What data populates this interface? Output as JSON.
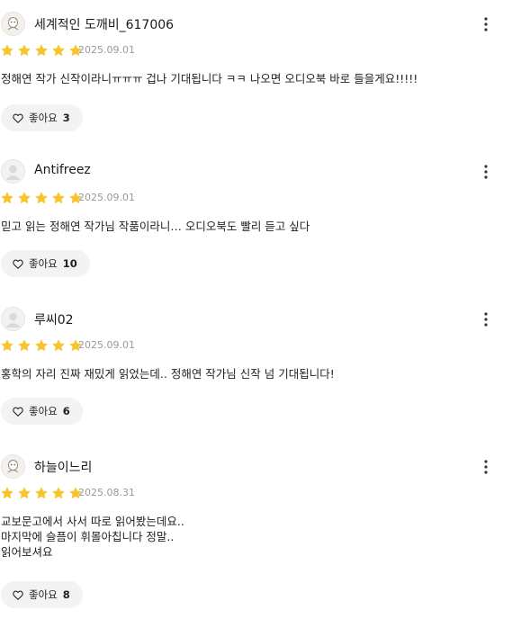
{
  "reviews": [
    {
      "username": "세계적인 도깨비_617006",
      "avatar": "doodle-avatar",
      "rating": 5,
      "date": "2025.09.01",
      "lines": [
        "정해연 작가 신작이라니ㅠㅠㅠ 겁나 기대됩니다 ㅋㅋ 나오면 오디오북 바로 들을게요!!!!!"
      ],
      "like_label": "좋아요",
      "like_count": "3"
    },
    {
      "username": "Antifreez",
      "avatar": "default-avatar",
      "rating": 5,
      "date": "2025.09.01",
      "lines": [
        "믿고 읽는 정해연 작가님 작품이라니… 오디오북도 빨리 듣고 싶다"
      ],
      "like_label": "좋아요",
      "like_count": "10"
    },
    {
      "username": "루씨02",
      "avatar": "default-avatar",
      "rating": 5,
      "date": "2025.09.01",
      "lines": [
        "홍학의 자리 진짜 재밌게 읽었는데.. 정해연 작가님 신작 넘 기대됩니다!"
      ],
      "like_label": "좋아요",
      "like_count": "6"
    },
    {
      "username": "하늘이느리",
      "avatar": "doodle-avatar",
      "rating": 5,
      "date": "2025.08.31",
      "lines": [
        "교보문고에서 사서 따로 읽어봤는데요..",
        "마지막에 슬픔이 휘몰아칩니다 정말..",
        "읽어보셔요"
      ],
      "like_label": "좋아요",
      "like_count": "8"
    }
  ],
  "colors": {
    "star": "#f7c42c",
    "date": "#999999",
    "like_bg": "#f3f3f3"
  },
  "icons": {
    "more": "more-vertical-icon",
    "like": "heart-outline-icon",
    "star": "star-icon"
  }
}
